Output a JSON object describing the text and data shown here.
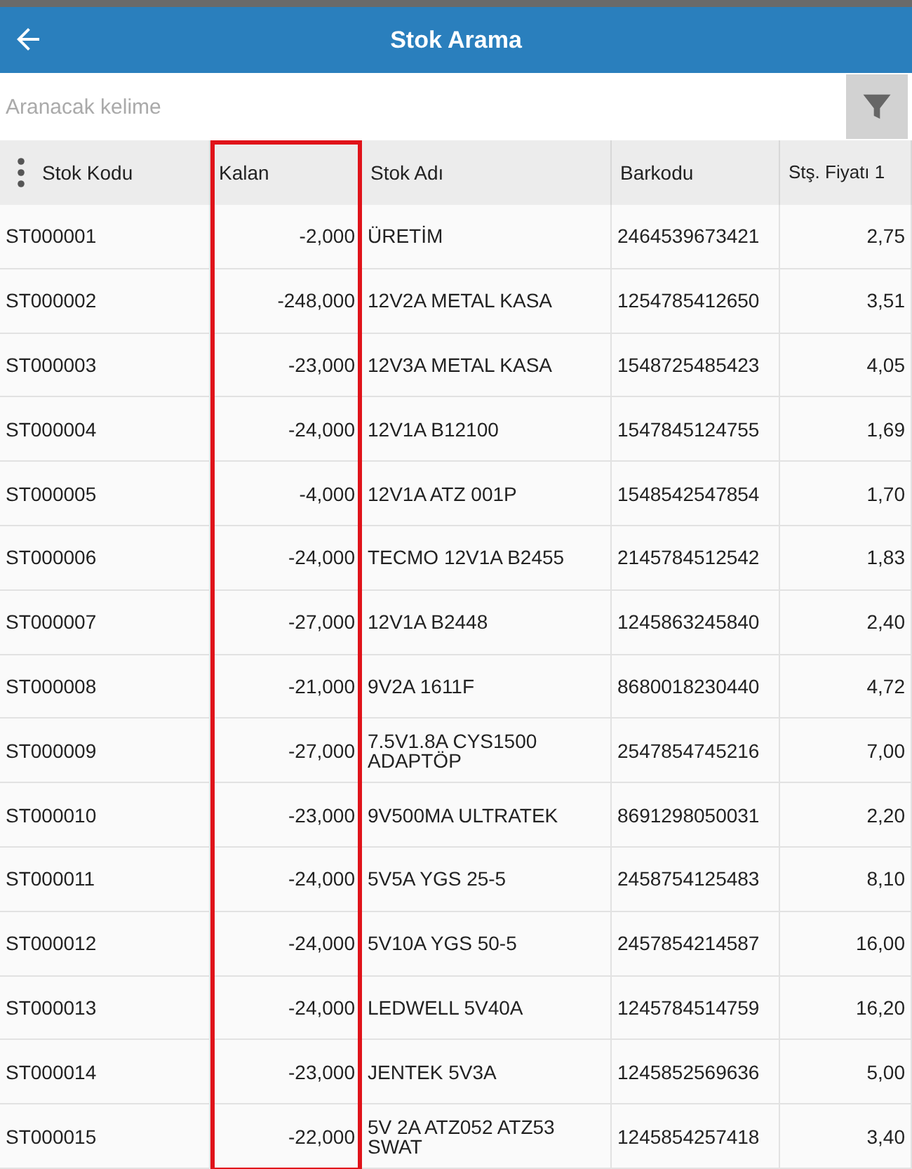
{
  "app_bar": {
    "title": "Stok Arama"
  },
  "search": {
    "placeholder": "Aranacak kelime"
  },
  "table": {
    "columns": [
      {
        "label": "Stok Kodu",
        "kind": "text",
        "highlighted": false
      },
      {
        "label": "Kalan",
        "kind": "number",
        "highlighted": true
      },
      {
        "label": "Stok Adı",
        "kind": "text",
        "highlighted": false
      },
      {
        "label": "Barkodu",
        "kind": "text",
        "highlighted": false
      },
      {
        "label": "Stş. Fiyatı 1",
        "kind": "number",
        "highlighted": false
      }
    ],
    "rows": [
      [
        "ST000001",
        "-2,000",
        "ÜRETİM",
        "2464539673421",
        "2,75"
      ],
      [
        "ST000002",
        "-248,000",
        "12V2A METAL KASA",
        "1254785412650",
        "3,51"
      ],
      [
        "ST000003",
        "-23,000",
        "12V3A METAL KASA",
        "1548725485423",
        "4,05"
      ],
      [
        "ST000004",
        "-24,000",
        "12V1A B12100",
        "1547845124755",
        "1,69"
      ],
      [
        "ST000005",
        "-4,000",
        "12V1A ATZ 001P",
        "1548542547854",
        "1,70"
      ],
      [
        "ST000006",
        "-24,000",
        "TECMO 12V1A B2455",
        "2145784512542",
        "1,83"
      ],
      [
        "ST000007",
        "-27,000",
        "12V1A B2448",
        "1245863245840",
        "2,40"
      ],
      [
        "ST000008",
        "-21,000",
        "9V2A 1611F",
        "8680018230440",
        "4,72"
      ],
      [
        "ST000009",
        "-27,000",
        "7.5V1.8A CYS1500 ADAPTÖP",
        "2547854745216",
        "7,00"
      ],
      [
        "ST000010",
        "-23,000",
        "9V500MA ULTRATEK",
        "8691298050031",
        "2,20"
      ],
      [
        "ST000011",
        "-24,000",
        "5V5A YGS 25-5",
        "2458754125483",
        "8,10"
      ],
      [
        "ST000012",
        "-24,000",
        "5V10A YGS 50-5",
        "2457854214587",
        "16,00"
      ],
      [
        "ST000013",
        "-24,000",
        "LEDWELL 5V40A",
        "1245784514759",
        "16,20"
      ],
      [
        "ST000014",
        "-23,000",
        "JENTEK 5V3A",
        "1245852569636",
        "5,00"
      ],
      [
        "ST000015",
        "-22,000",
        "5V 2A ATZ052 ATZ53 SWAT",
        "1245854257418",
        "3,40"
      ]
    ]
  }
}
